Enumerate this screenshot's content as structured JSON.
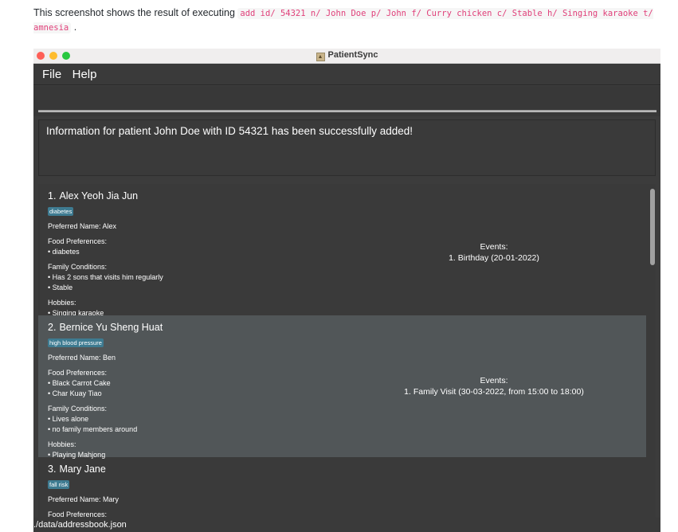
{
  "intro": {
    "prefix": "This screenshot shows the result of executing",
    "command": "add id/ 54321 n/ John Doe p/ John f/ Curry chicken c/ Stable h/ Singing karaoke t/ amnesia",
    "suffix": "."
  },
  "window": {
    "title": "PatientSync",
    "menu": [
      "File",
      "Help"
    ]
  },
  "command_box": {
    "value": ""
  },
  "result": {
    "message": "Information for patient John Doe with ID 54321 has been successfully added!"
  },
  "patients": [
    {
      "index": "1.",
      "name": "Alex Yeoh Jia Jun",
      "tag": "diabetes",
      "preferred_name": "Preferred Name: Alex",
      "food_label": "Food Preferences:",
      "food": [
        "• diabetes"
      ],
      "family_label": "Family Conditions:",
      "family": [
        "• Has 2 sons that visits him regularly",
        "• Stable"
      ],
      "hobbies_label": "Hobbies:",
      "hobbies": [
        "• Singing karaoke"
      ],
      "events_label": "Events:",
      "events": [
        "1. Birthday (20-01-2022)"
      ]
    },
    {
      "index": "2.",
      "name": "Bernice Yu Sheng Huat",
      "tag": "high blood pressure",
      "preferred_name": "Preferred Name: Ben",
      "food_label": "Food Preferences:",
      "food": [
        "• Black Carrot Cake",
        "• Char Kuay Tiao"
      ],
      "family_label": "Family Conditions:",
      "family": [
        "• Lives alone",
        "• no family members around"
      ],
      "hobbies_label": "Hobbies:",
      "hobbies": [
        "• Playing Mahjong"
      ],
      "events_label": "Events:",
      "events": [
        "1. Family Visit (30-03-2022, from 15:00 to 18:00)"
      ]
    },
    {
      "index": "3.",
      "name": "Mary Jane",
      "tag": "fall risk",
      "preferred_name": "Preferred Name: Mary",
      "food_label": "Food Preferences:"
    }
  ],
  "status": {
    "path": "./data/addressbook.json"
  },
  "colors": {
    "accent_tag": "#3e7b91",
    "window_bg": "#3c3c3c",
    "selected_card": "#515658"
  }
}
